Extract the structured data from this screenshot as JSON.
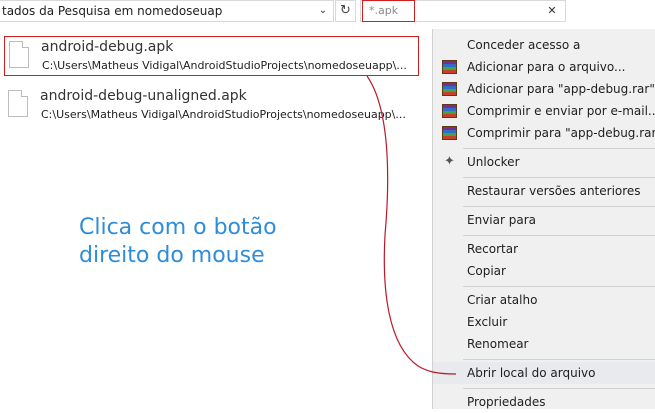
{
  "address_bar": {
    "text": "tados da Pesquisa em nomedoseuap"
  },
  "search": {
    "value": "*.apk"
  },
  "results": [
    {
      "name": "android-debug.apk",
      "path": "C:\\Users\\Matheus Vidigal\\AndroidStudioProjects\\nomedoseuapp\\..."
    },
    {
      "name": "android-debug-unaligned.apk",
      "path": "C:\\Users\\Matheus Vidigal\\AndroidStudioProjects\\nomedoseuapp\\..."
    }
  ],
  "annotation": {
    "line1": "Clica com o botão",
    "line2": "direito do mouse",
    "color": "#2f8dd8"
  },
  "context_menu": {
    "items": [
      {
        "label": "Conceder acesso a",
        "icon": ""
      },
      {
        "label": "Adicionar para o arquivo...",
        "icon": "winrar-icon"
      },
      {
        "label": "Adicionar para \"app-debug.rar\"",
        "icon": "winrar-icon"
      },
      {
        "label": "Comprimir e enviar por e-mail...",
        "icon": "winrar-icon"
      },
      {
        "label": "Comprimir para \"app-debug.rar\" e e",
        "icon": "winrar-icon"
      },
      {
        "label": "Unlocker",
        "icon": "wand-icon"
      },
      {
        "label": "Restaurar versões anteriores",
        "icon": ""
      },
      {
        "label": "Enviar para",
        "icon": ""
      },
      {
        "label": "Recortar",
        "icon": ""
      },
      {
        "label": "Copiar",
        "icon": ""
      },
      {
        "label": "Criar atalho",
        "icon": ""
      },
      {
        "label": "Excluir",
        "icon": ""
      },
      {
        "label": "Renomear",
        "icon": ""
      },
      {
        "label": "Abrir local do arquivo",
        "icon": ""
      },
      {
        "label": "Propriedades",
        "icon": ""
      }
    ]
  },
  "colors": {
    "highlight_border": "#d11f1f",
    "menu_background": "#f0f0f0"
  }
}
